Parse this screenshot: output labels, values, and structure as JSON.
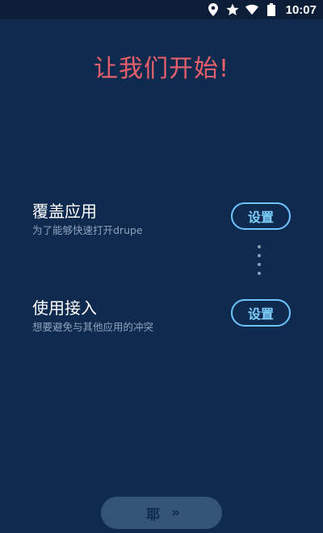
{
  "status_bar": {
    "time": "10:07",
    "icons": [
      "location-icon",
      "star-icon",
      "wifi-icon",
      "battery-icon"
    ]
  },
  "title": "让我们开始!",
  "features": [
    {
      "title": "覆盖应用",
      "subtitle": "为了能够快速打开drupe",
      "button_label": "设置"
    },
    {
      "title": "使用接入",
      "subtitle": "想要避免与其他应用的冲突",
      "button_label": "设置"
    }
  ],
  "next_button": {
    "label": "耶",
    "arrow": "»"
  },
  "colors": {
    "background": "#0f2a4f",
    "status_bar": "#0b1d37",
    "title": "#e8606a",
    "accent": "#6ec6ff",
    "subtitle": "#8fa3bd",
    "next_button_bg": "#345476"
  }
}
